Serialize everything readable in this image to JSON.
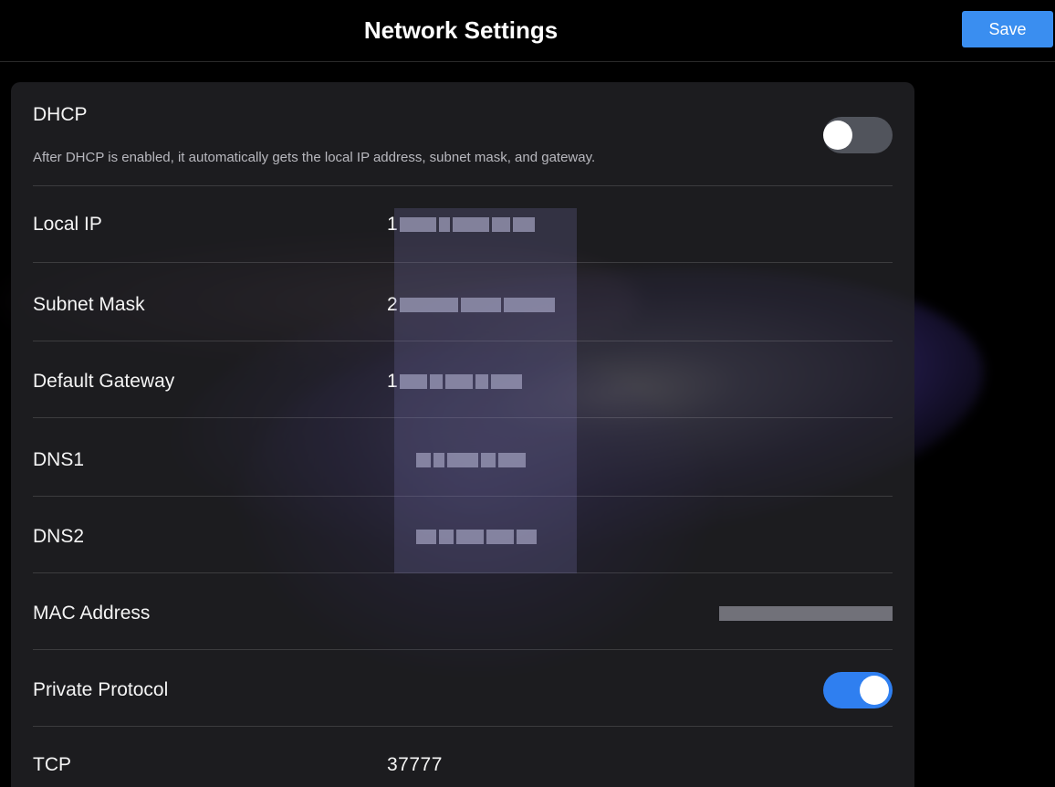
{
  "header": {
    "title": "Network Settings",
    "save_label": "Save"
  },
  "dhcp": {
    "label": "DHCP",
    "description": "After DHCP is enabled, it automatically gets the local IP address, subnet mask, and gateway.",
    "enabled": false
  },
  "fields": {
    "local_ip": {
      "label": "Local IP",
      "value_visible": "1"
    },
    "subnet_mask": {
      "label": "Subnet Mask",
      "value_visible": "2"
    },
    "default_gateway": {
      "label": "Default Gateway",
      "value_visible": "1"
    },
    "dns1": {
      "label": "DNS1"
    },
    "dns2": {
      "label": "DNS2"
    },
    "mac_address": {
      "label": "MAC Address"
    }
  },
  "private_protocol": {
    "label": "Private Protocol",
    "enabled": true
  },
  "tcp": {
    "label": "TCP",
    "value": "37777"
  },
  "colors": {
    "accent": "#3a8ef0",
    "toggle_on": "#2f7ff0",
    "toggle_off": "#51545c",
    "panel": "#242428"
  },
  "icons": {
    "dhcp_toggle": "toggle-switch-icon",
    "private_protocol_toggle": "toggle-switch-icon"
  }
}
